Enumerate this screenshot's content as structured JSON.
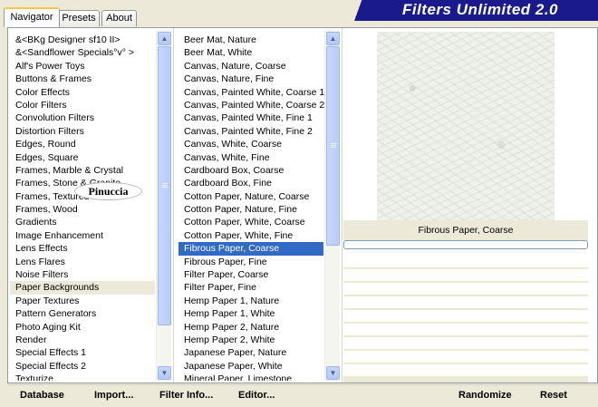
{
  "tabs": [
    "Navigator",
    "Presets",
    "About"
  ],
  "banner": {
    "title": "Filters Unlimited 2.0"
  },
  "categories": [
    "&<BKg Designer sf10 II>",
    "&<Sandflower Specials°v° >",
    "Alf's Power Toys",
    "Buttons & Frames",
    "Color Effects",
    "Color Filters",
    "Convolution Filters",
    "Distortion Filters",
    "Edges, Round",
    "Edges, Square",
    "Frames, Marble & Crystal",
    "Frames, Stone & Granite",
    "Frames, Textured",
    "Frames, Wood",
    "Gradients",
    "Image Enhancement",
    "Lens Effects",
    "Lens Flares",
    "Noise Filters",
    "Paper Backgrounds",
    "Paper Textures",
    "Pattern Generators",
    "Photo Aging Kit",
    "Render",
    "Special Effects 1",
    "Special Effects 2",
    "Texturize"
  ],
  "selected_category": "Paper Backgrounds",
  "filters": [
    "Beer Mat, Nature",
    "Beer Mat, White",
    "Canvas, Nature, Coarse",
    "Canvas, Nature, Fine",
    "Canvas, Painted White, Coarse 1",
    "Canvas, Painted White, Coarse 2",
    "Canvas, Painted White, Fine 1",
    "Canvas, Painted White, Fine 2",
    "Canvas, White, Coarse",
    "Canvas, White, Fine",
    "Cardboard Box, Coarse",
    "Cardboard Box, Fine",
    "Cotton Paper, Nature, Coarse",
    "Cotton Paper, Nature, Fine",
    "Cotton Paper, White, Coarse",
    "Cotton Paper, White, Fine",
    "Fibrous Paper, Coarse",
    "Fibrous Paper, Fine",
    "Filter Paper, Coarse",
    "Filter Paper, Fine",
    "Hemp Paper 1, Nature",
    "Hemp Paper 1, White",
    "Hemp Paper 2, Nature",
    "Hemp Paper 2, White",
    "Japanese Paper, Nature",
    "Japanese Paper, White",
    "Mineral Paper, Limestone"
  ],
  "selected_filter": "Fibrous Paper, Coarse",
  "preview_label": "Fibrous Paper, Coarse",
  "watermark": "Pinuccia",
  "footer": {
    "database": "Database",
    "import": "Import...",
    "filter_info": "Filter Info...",
    "editor": "Editor...",
    "randomize": "Randomize",
    "reset": "Reset"
  },
  "icons": {
    "scroll_up": "up-arrow-icon",
    "scroll_down": "down-arrow-icon"
  },
  "colors": {
    "banner": "#1a1a8c",
    "selection": "#316ac5",
    "tab_accent": "#ffc83c"
  }
}
